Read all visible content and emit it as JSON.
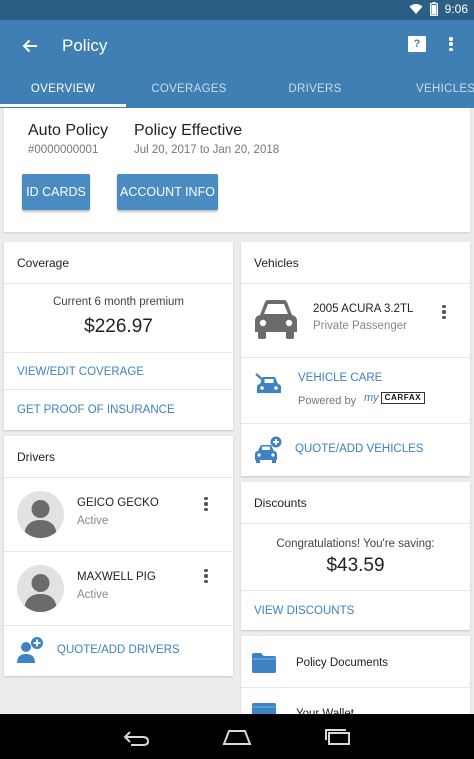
{
  "status_bar": {
    "time": "9:06"
  },
  "app_bar": {
    "title": "Policy"
  },
  "tabs": [
    {
      "label": "OVERVIEW",
      "active": true
    },
    {
      "label": "COVERAGES",
      "active": false
    },
    {
      "label": "DRIVERS",
      "active": false
    },
    {
      "label": "VEHICLES",
      "active": false
    }
  ],
  "policy": {
    "name": "Auto Policy",
    "number": "#0000000001",
    "effective_title": "Policy Effective",
    "effective_dates": "Jul 20, 2017 to Jan 20, 2018",
    "id_cards_label": "ID CARDS",
    "account_info_label": "ACCOUNT INFO"
  },
  "coverage": {
    "header": "Coverage",
    "premium_label": "Current 6 month premium",
    "premium_value": "$226.97",
    "view_edit_label": "VIEW/EDIT COVERAGE",
    "proof_label": "GET PROOF OF INSURANCE"
  },
  "drivers": {
    "header": "Drivers",
    "items": [
      {
        "name": "GEICO GECKO",
        "status": "Active"
      },
      {
        "name": "MAXWELL PIG",
        "status": "Active"
      }
    ],
    "add_label": "QUOTE/ADD DRIVERS"
  },
  "vehicles": {
    "header": "Vehicles",
    "items": [
      {
        "name": "2005 ACURA 3.2TL",
        "use": "Private Passenger"
      }
    ],
    "care_label": "VEHICLE CARE",
    "powered_by": "Powered by",
    "carfax_my": "my",
    "carfax_brand": "CARFAX",
    "add_label": "QUOTE/ADD VEHICLES"
  },
  "discounts": {
    "header": "Discounts",
    "congrats": "Congratulations! You're saving:",
    "amount": "$43.59",
    "view_label": "VIEW DISCOUNTS"
  },
  "documents": {
    "items": [
      {
        "label": "Policy Documents"
      },
      {
        "label": "Your Wallet"
      }
    ]
  },
  "colors": {
    "status_bar": "#2c5f86",
    "app_bar": "#3f7fb3",
    "button": "#4a8cc2",
    "link": "#3d82c2",
    "background": "#ececec"
  },
  "icons": {
    "back": "arrow-left-icon",
    "help": "help-icon",
    "more": "more-vert-icon",
    "car": "car-icon",
    "vehicle_care": "car-repair-icon",
    "add_vehicle": "car-add-icon",
    "add_driver": "person-add-icon",
    "folder": "folder-icon",
    "wallet": "wallet-icon"
  }
}
